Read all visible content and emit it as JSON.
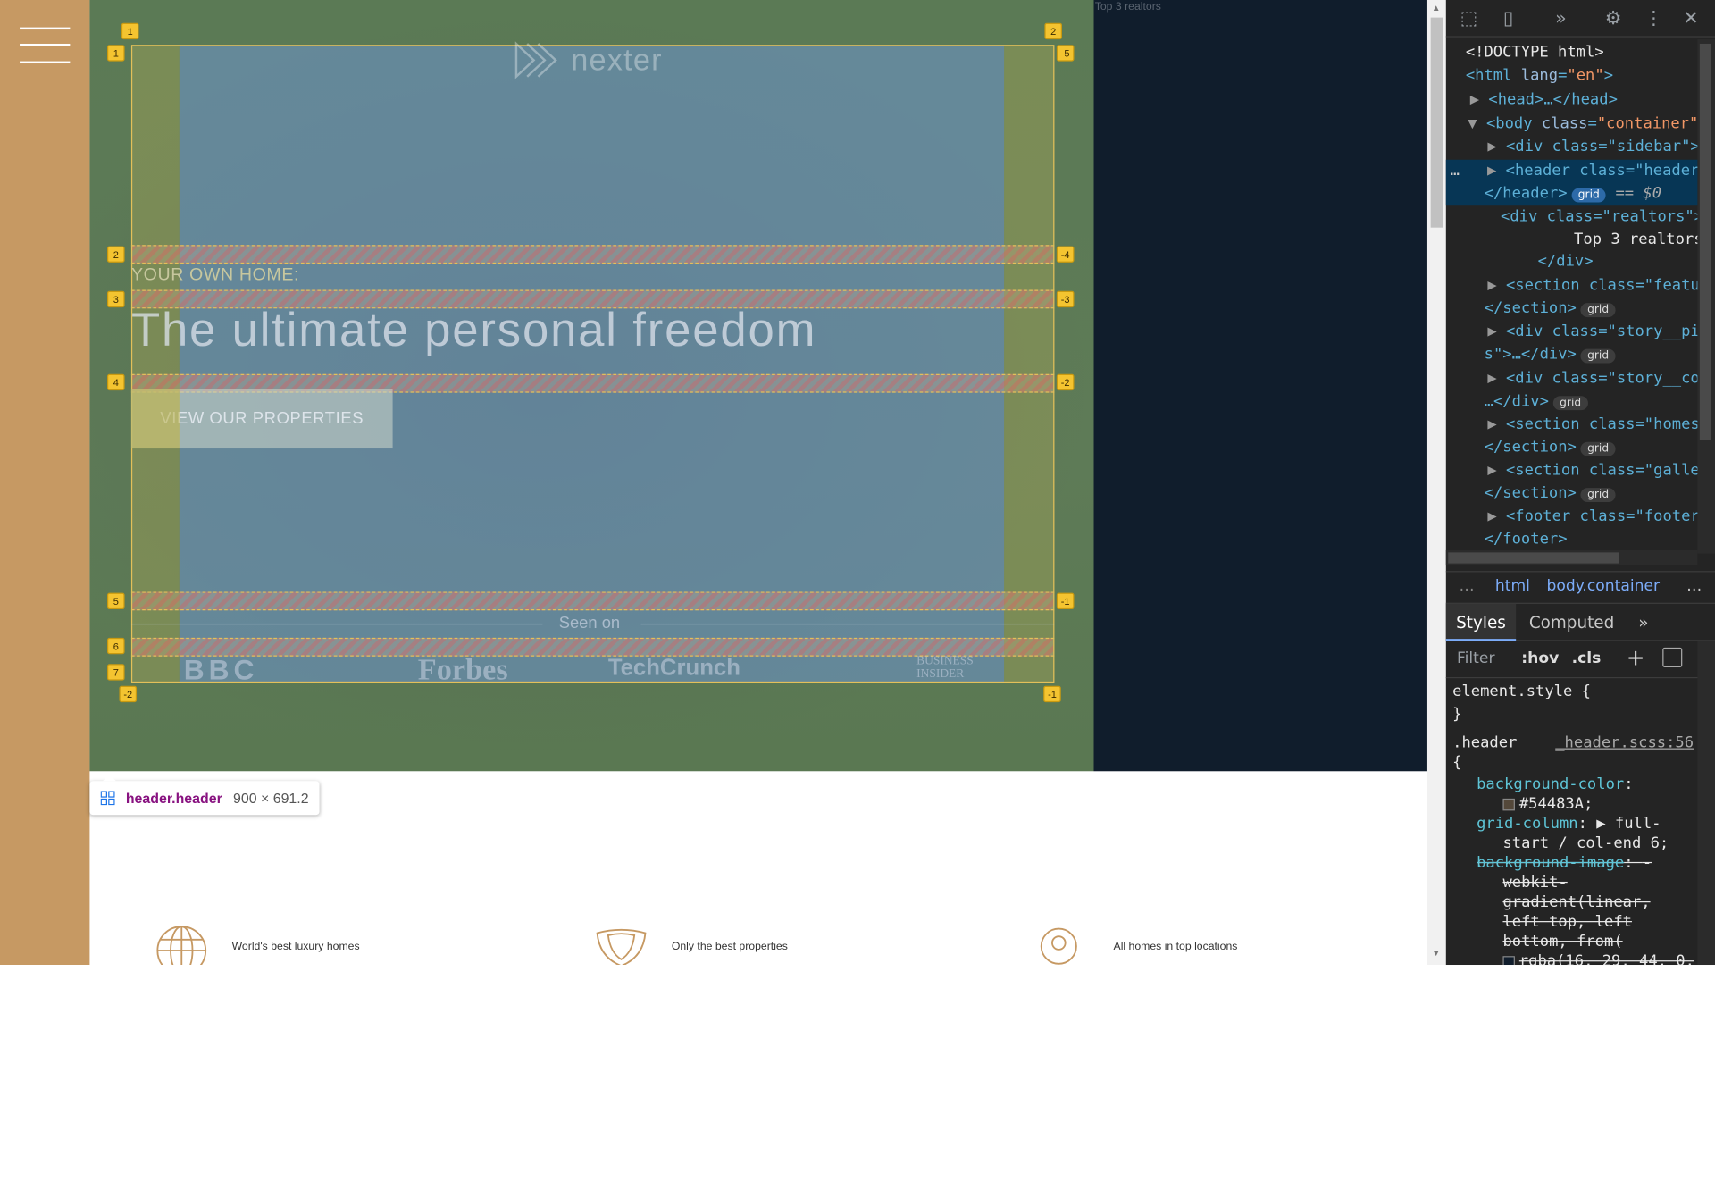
{
  "page": {
    "realtors_title": "Top 3 realtors",
    "logo_text": "nexter",
    "sub_heading": "YOUR OWN HOME:",
    "heading": "The ultimate personal freedom",
    "cta_label": "VIEW OUR PROPERTIES",
    "seen_on": "Seen on",
    "brands": [
      "BBC",
      "Forbes",
      "TechCrunch",
      "BUSINESS INSIDER"
    ],
    "features": [
      {
        "text": "World's best luxury homes",
        "icon": "globe-icon"
      },
      {
        "text": "Only the best properties",
        "icon": "trophy-icon"
      },
      {
        "text": "All homes in top locations",
        "icon": "map-pin-icon"
      }
    ]
  },
  "grid_overlay": {
    "badges": [
      "1",
      "2",
      "-5",
      "2",
      "-4",
      "3",
      "-3",
      "4",
      "-2",
      "5",
      "-1",
      "6",
      "7",
      "-2",
      "-1",
      "1"
    ]
  },
  "tooltip": {
    "element": "header.header",
    "size": "900 × 691.2"
  },
  "devtools": {
    "dom": {
      "doctype": "<!DOCTYPE html>",
      "html_tag": "html",
      "html_attr": "lang",
      "html_val": "\"en\"",
      "head": "<head>…</head>",
      "body_tag": "body",
      "body_attr": "class",
      "body_val": "\"container\"",
      "sidebar": "<div class=\"sidebar\">…",
      "header_open": "<header class=\"header\"",
      "header_close": "</header>",
      "selected_marker": "== $0",
      "realtors_open": "<div class=\"realtors\">",
      "realtors_text": "Top 3 realtors",
      "div_close": "</div>",
      "features_open": "<section class=\"featur",
      "section_close": "</section>",
      "story_pics_open": "<div class=\"story__pic",
      "story_pics_close": "s\">…</div>",
      "story_content_open": "<div class=\"story__con",
      "story_content_close": "…</div>",
      "homes_open": "<section class=\"homes\"",
      "gallery_open": "<section class=\"galler",
      "footer_open": "<footer class=\"footer\"",
      "footer_close": "</footer>",
      "grid_pill": "grid",
      "ellipsis": "…"
    },
    "breadcrumb": {
      "more": "…",
      "html": "html",
      "body": "body.container",
      "trail": "…"
    },
    "tabs": {
      "styles": "Styles",
      "computed": "Computed",
      "more": "»"
    },
    "filter": {
      "placeholder": "Filter",
      "hov": ":hov",
      "cls": ".cls",
      "add": "+"
    },
    "styles": {
      "element_style": "element.style {",
      "close_brace": "}",
      "selector": ".header",
      "source": "_header.scss:56",
      "open_brace": "{",
      "bg_prop": "background-color",
      "bg_val": "#54483A;",
      "bg_color": "#54483A",
      "grid_col_prop": "grid-column",
      "grid_col_val": "full-",
      "grid_col_val2": "start / col-end 6;",
      "bg_img_prop": "background-image",
      "bg_img_val": "-",
      "bg_img_l1": "webkit-",
      "bg_img_l2": "gradient(linear,",
      "bg_img_l3": "left top, left",
      "bg_img_l4": "bottom, from(",
      "bg_img_l5": "rgba(16, 29, 44, 0."
    }
  }
}
